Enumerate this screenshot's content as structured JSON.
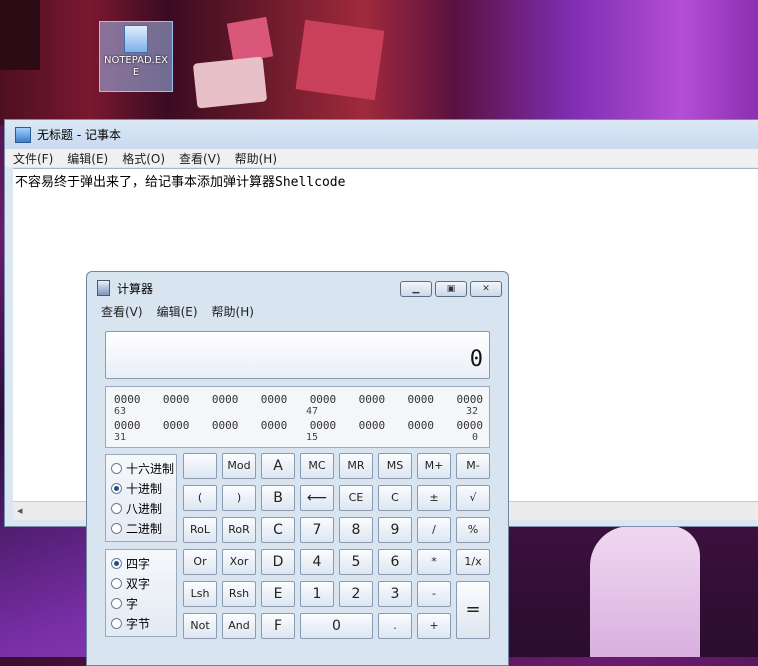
{
  "desktop_icon": {
    "label": "NOTEPAD.EXE"
  },
  "notepad": {
    "title": "无标题 - 记事本",
    "menu": [
      "文件(F)",
      "编辑(E)",
      "格式(O)",
      "查看(V)",
      "帮助(H)"
    ],
    "text": "不容易终于弹出来了，给记事本添加弹计算器Shellcode"
  },
  "calculator": {
    "title": "计算器",
    "menu": [
      "查看(V)",
      "编辑(E)",
      "帮助(H)"
    ],
    "display": "0",
    "bits": {
      "row1": [
        "0000",
        "0000",
        "0000",
        "0000",
        "0000",
        "0000",
        "0000",
        "0000"
      ],
      "row1_labels": {
        "left": "63",
        "mid": "47",
        "right": "32"
      },
      "row2": [
        "0000",
        "0000",
        "0000",
        "0000",
        "0000",
        "0000",
        "0000",
        "0000"
      ],
      "row2_labels": {
        "left": "31",
        "mid": "15",
        "right": "0"
      }
    },
    "base_options": [
      "十六进制",
      "十进制",
      "八进制",
      "二进制"
    ],
    "base_selected": "十进制",
    "word_options": [
      "四字",
      "双字",
      "字",
      "字节"
    ],
    "word_selected": "四字",
    "keys": {
      "row1": [
        "",
        "Mod",
        "A",
        "MC",
        "MR",
        "MS",
        "M+",
        "M-"
      ],
      "row2": [
        "(",
        ")",
        "B",
        "⟵",
        "CE",
        "C",
        "±",
        "√"
      ],
      "row3": [
        "RoL",
        "RoR",
        "C",
        "7",
        "8",
        "9",
        "/",
        "%"
      ],
      "row4": [
        "Or",
        "Xor",
        "D",
        "4",
        "5",
        "6",
        "*",
        "1/x"
      ],
      "row5": [
        "Lsh",
        "Rsh",
        "E",
        "1",
        "2",
        "3",
        "-",
        "="
      ],
      "row6": [
        "Not",
        "And",
        "F",
        "0",
        ".",
        "+"
      ]
    }
  }
}
